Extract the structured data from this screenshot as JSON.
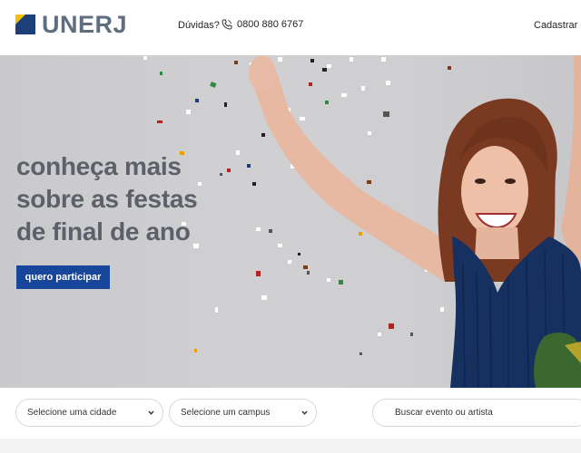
{
  "header": {
    "logo_text": "UNERJ",
    "help_label": "Dúvidas?",
    "phone_number": "0800 880 6767",
    "register_label": "Cadastrar ev"
  },
  "hero": {
    "title_lines": [
      "conheça mais",
      "sobre as festas",
      "de final de ano"
    ],
    "cta_label": "quero participar"
  },
  "filters": {
    "city_value": "Selecione uma cidade",
    "campus_value": "Selecione um campus",
    "search_placeholder": "Buscar evento ou artista"
  },
  "colors": {
    "brand_blue": "#17469a",
    "logo_grey": "#5f6e7f",
    "logo_yellow": "#f2c200",
    "title_grey": "#5c6069"
  },
  "icons": {
    "phone": "phone-icon",
    "chevron": "chevron-down-icon",
    "logo": "logo-mark-icon"
  }
}
